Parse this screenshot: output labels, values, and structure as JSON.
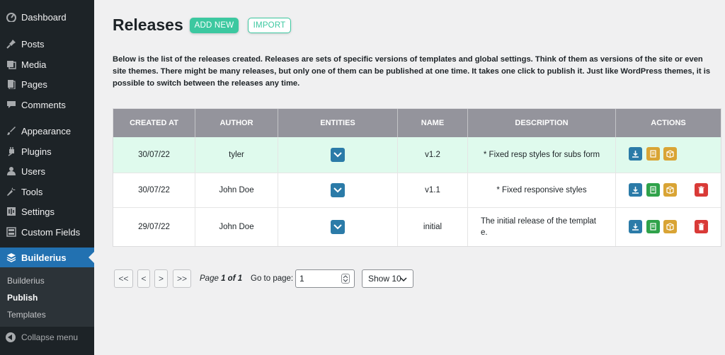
{
  "sidebar": {
    "items": [
      {
        "label": "Dashboard",
        "icon": "dashboard-icon"
      },
      {
        "label": "Posts",
        "icon": "pin-icon"
      },
      {
        "label": "Media",
        "icon": "media-icon"
      },
      {
        "label": "Pages",
        "icon": "pages-icon"
      },
      {
        "label": "Comments",
        "icon": "comment-icon"
      },
      {
        "label": "Appearance",
        "icon": "brush-icon"
      },
      {
        "label": "Plugins",
        "icon": "plugin-icon"
      },
      {
        "label": "Users",
        "icon": "user-icon"
      },
      {
        "label": "Tools",
        "icon": "wrench-icon"
      },
      {
        "label": "Settings",
        "icon": "settings-icon"
      },
      {
        "label": "Custom Fields",
        "icon": "fields-icon"
      },
      {
        "label": "Builderius",
        "icon": "layers-icon"
      }
    ],
    "submenu": [
      "Builderius",
      "Publish",
      "Templates"
    ],
    "collapse_label": "Collapse menu"
  },
  "header": {
    "title": "Releases",
    "add_label": "ADD NEW",
    "import_label": "IMPORT"
  },
  "description": "Below is the list of the releases created. Releases are sets of specific versions of templates and global settings. Think of them as versions of the site or even site themes. There might be many releases, but only one of them can be published at one time. It takes one click to publish it. Just like WordPress themes, it is possible to switch between the releases any time.",
  "table": {
    "columns": [
      "CREATED AT",
      "AUTHOR",
      "ENTITIES",
      "NAME",
      "DESCRIPTION",
      "ACTIONS"
    ],
    "rows": [
      {
        "created": "30/07/22",
        "author": "tyler",
        "name": "v1.2",
        "description": "* Fixed resp styles for subs form"
      },
      {
        "created": "30/07/22",
        "author": "John Doe",
        "name": "v1.1",
        "description": "* Fixed responsive styles"
      },
      {
        "created": "29/07/22",
        "author": "John Doe",
        "name": "initial",
        "description": "The initial release of the templat e."
      }
    ]
  },
  "pagination": {
    "first": "<<",
    "prev": "<",
    "next": ">",
    "last": ">>",
    "page_prefix": "Page",
    "page_current": "1",
    "page_of": "of",
    "page_total": "1",
    "goto_label": "Go to page:",
    "goto_value": "1",
    "show_label": "Show 10"
  },
  "colors": {
    "accent": "#3cc8a0",
    "sidebar_bg": "#1d2327",
    "active_menu": "#2271b1",
    "highlight_row": "#dffaed",
    "header_row": "#94949c"
  }
}
